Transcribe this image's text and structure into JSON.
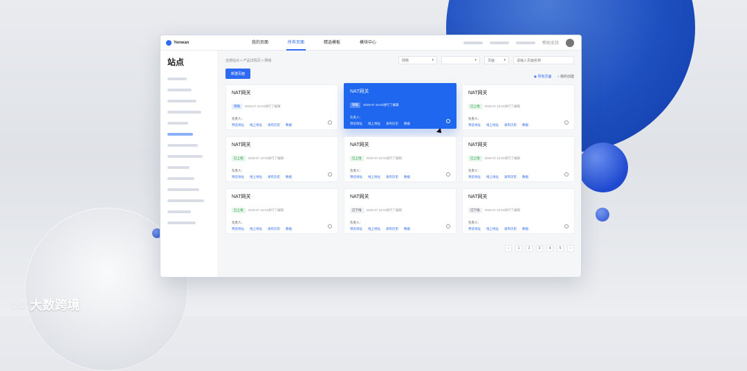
{
  "brand": "大数跨境",
  "side": {
    "title": "站点",
    "active": 5,
    "count": 14
  },
  "crumb": "全部站点 > 产品详情页 > 网络",
  "filters": [
    "网络",
    "",
    "页面"
  ],
  "search_ph": "请输入页面名称",
  "new_btn": "新建页面",
  "radios": [
    "所有页面",
    "我的创建"
  ],
  "nav": [
    "我的页面",
    "所有页面",
    "精选模板",
    "模块中心"
  ],
  "cards": [
    {
      "title": "NAT网关",
      "status": "草稿",
      "cls": "b",
      "meta": "2025-07 16:03进行了编辑"
    },
    {
      "title": "NAT网关",
      "status": "草稿",
      "cls": "b",
      "meta": "2025-07 16:03进行了编辑",
      "hl": true
    },
    {
      "title": "NAT网关",
      "status": "已上线",
      "cls": "g",
      "meta": "2025-07 16:03进行了编辑"
    },
    {
      "title": "NAT网关",
      "status": "已上线",
      "cls": "g",
      "meta": "2025-07 16:03进行了编辑"
    },
    {
      "title": "NAT网关",
      "status": "已上线",
      "cls": "g",
      "meta": "2025-07 16:03进行了编辑"
    },
    {
      "title": "NAT网关",
      "status": "已上线",
      "cls": "g",
      "meta": "2025-07 16:03进行了编辑"
    },
    {
      "title": "NAT网关",
      "status": "已上线",
      "cls": "g",
      "meta": "2025-07 16:03进行了编辑"
    },
    {
      "title": "NAT网关",
      "status": "已下线",
      "cls": "",
      "meta": "2025-07 16:03进行了编辑"
    },
    {
      "title": "NAT网关",
      "status": "已下线",
      "cls": "",
      "meta": "2025-07 16:03进行了编辑"
    }
  ],
  "owner": "负责人",
  "links": [
    "预览地址",
    "线上地址",
    "发布历史",
    "数据"
  ],
  "pages": [
    "‹",
    "1",
    "2",
    "3",
    "4",
    "5",
    "›"
  ]
}
